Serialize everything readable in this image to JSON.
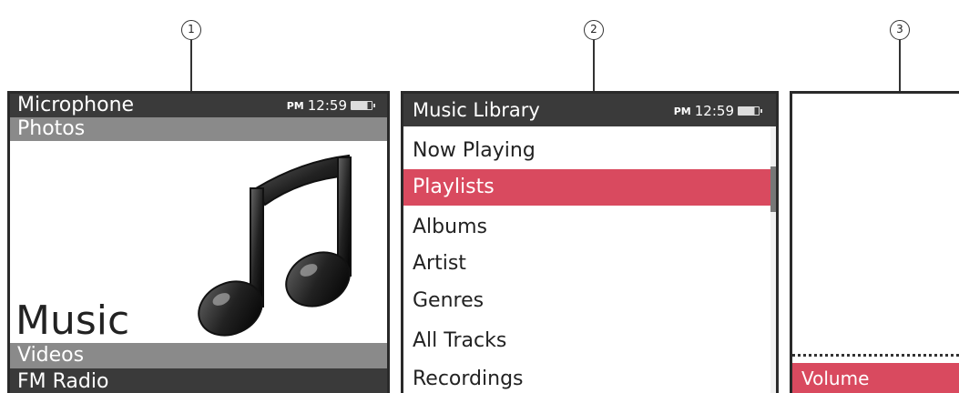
{
  "callouts": [
    "1",
    "2",
    "3"
  ],
  "screen1": {
    "top_item": "Microphone",
    "second_item": "Photos",
    "status": {
      "pm": "PM",
      "time": "12:59"
    },
    "main_item": "Music",
    "next_item": "Videos",
    "last_item": "FM Radio",
    "icon": "music-note-icon"
  },
  "screen2": {
    "header": "Music Library",
    "status": {
      "pm": "PM",
      "time": "12:59"
    },
    "menu_items": [
      "Now Playing",
      "Playlists",
      "Albums",
      "Artist",
      "Genres",
      "All Tracks",
      "Recordings"
    ],
    "selected_item": "Playlists",
    "accent_color": "#d94a5f"
  },
  "screen3": {
    "volume_label": "Volume"
  }
}
